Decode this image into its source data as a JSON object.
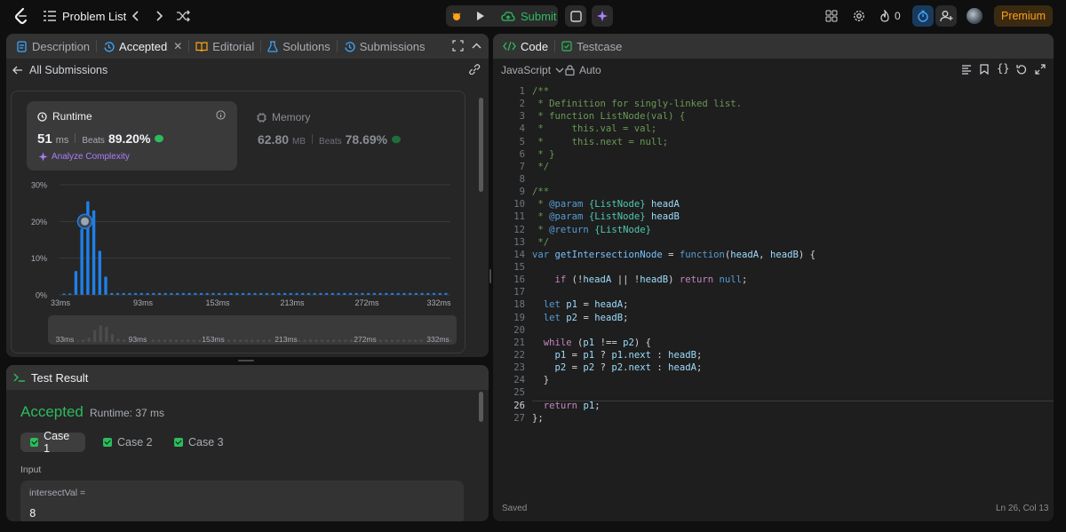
{
  "nav": {
    "problem_list": "Problem List",
    "submit": "Submit",
    "fire_count": "0",
    "premium": "Premium"
  },
  "left_tabs": {
    "description": "Description",
    "accepted": "Accepted",
    "editorial": "Editorial",
    "solutions": "Solutions",
    "submissions": "Submissions"
  },
  "submission": {
    "back_label": "All Submissions",
    "runtime_title": "Runtime",
    "runtime_value": "51",
    "runtime_unit": "ms",
    "beats_label": "Beats",
    "runtime_beats": "89.20%",
    "analyze": "Analyze Complexity",
    "memory_title": "Memory",
    "memory_value": "62.80",
    "memory_unit": "MB",
    "memory_beats": "78.69%"
  },
  "chart_data": {
    "type": "bar",
    "y_ticks": [
      "30%",
      "20%",
      "10%",
      "0%"
    ],
    "x_ticks": [
      "33ms",
      "93ms",
      "153ms",
      "213ms",
      "272ms",
      "332ms"
    ],
    "ylim": [
      0,
      30
    ],
    "values": [
      0.3,
      0.4,
      6.5,
      18,
      25.5,
      23,
      12,
      5,
      0.5,
      0.5,
      0.5,
      0.5,
      0.5,
      0.5,
      0.5,
      0.5,
      0.5,
      0.5,
      0.5,
      0.5,
      0.5,
      0.5,
      0.5,
      0.5,
      0.5,
      0.5,
      0.5,
      0.5,
      0.5,
      0.5,
      0.5,
      0.5,
      0.5,
      0.5,
      0.5,
      0.5,
      0.5,
      0.5,
      0.5,
      0.5,
      0.5,
      0.5,
      0.5,
      0.5,
      0.5,
      0.5,
      0.5,
      0.5,
      0.5,
      0.5,
      0.5,
      0.5,
      0.5,
      0.5,
      0.5,
      0.5,
      0.5,
      0.5,
      0.5,
      0.5,
      0.5,
      0.5,
      0.5,
      0.5,
      0.5
    ],
    "colors": {
      "bar": "#1f7fe8",
      "grid": "#3a3a3a",
      "mini_bar": "#4d4d4d"
    }
  },
  "test_result": {
    "title": "Test Result",
    "status": "Accepted",
    "runtime": "Runtime: 37 ms",
    "cases": [
      "Case 1",
      "Case 2",
      "Case 3"
    ],
    "input_label": "Input",
    "var_label": "intersectVal =",
    "var_value": "8"
  },
  "code_panel": {
    "tab_code": "Code",
    "tab_testcase": "Testcase",
    "language": "JavaScript",
    "auto": "Auto",
    "saved": "Saved",
    "position": "Ln 26, Col 13",
    "lines": [
      [
        [
          "c-cm",
          "/**"
        ]
      ],
      [
        [
          "c-cm",
          " * Definition for singly-linked list."
        ]
      ],
      [
        [
          "c-cm",
          " * function ListNode(val) {"
        ]
      ],
      [
        [
          "c-cm",
          " *     this.val = val;"
        ]
      ],
      [
        [
          "c-cm",
          " *     this.next = null;"
        ]
      ],
      [
        [
          "c-cm",
          " * }"
        ]
      ],
      [
        [
          "c-cm",
          " */"
        ]
      ],
      [],
      [
        [
          "c-cm",
          "/**"
        ]
      ],
      [
        [
          "c-cm",
          " * "
        ],
        [
          "c-bl",
          "@param"
        ],
        [
          "c-cm",
          " "
        ],
        [
          "c-ty",
          "{ListNode}"
        ],
        [
          "c-cm",
          " "
        ],
        [
          "c-id",
          "headA"
        ]
      ],
      [
        [
          "c-cm",
          " * "
        ],
        [
          "c-bl",
          "@param"
        ],
        [
          "c-cm",
          " "
        ],
        [
          "c-ty",
          "{ListNode}"
        ],
        [
          "c-cm",
          " "
        ],
        [
          "c-id",
          "headB"
        ]
      ],
      [
        [
          "c-cm",
          " * "
        ],
        [
          "c-bl",
          "@return"
        ],
        [
          "c-cm",
          " "
        ],
        [
          "c-ty",
          "{ListNode}"
        ]
      ],
      [
        [
          "c-cm",
          " */"
        ]
      ],
      [
        [
          "c-bl",
          "var"
        ],
        [
          "c-tx",
          " "
        ],
        [
          "c-fn",
          "getIntersectionNode"
        ],
        [
          "c-tx",
          " = "
        ],
        [
          "c-bl",
          "function"
        ],
        [
          "c-tx",
          "("
        ],
        [
          "c-id",
          "headA"
        ],
        [
          "c-tx",
          ", "
        ],
        [
          "c-id",
          "headB"
        ],
        [
          "c-tx",
          ") {"
        ]
      ],
      [],
      [
        [
          "c-tx",
          "    "
        ],
        [
          "c-kw",
          "if"
        ],
        [
          "c-tx",
          " (!"
        ],
        [
          "c-id",
          "headA"
        ],
        [
          "c-tx",
          " || !"
        ],
        [
          "c-id",
          "headB"
        ],
        [
          "c-tx",
          ") "
        ],
        [
          "c-kw",
          "return"
        ],
        [
          "c-tx",
          " "
        ],
        [
          "c-bl",
          "null"
        ],
        [
          "c-tx",
          ";"
        ]
      ],
      [],
      [
        [
          "c-tx",
          "  "
        ],
        [
          "c-bl",
          "let"
        ],
        [
          "c-tx",
          " "
        ],
        [
          "c-id",
          "p1"
        ],
        [
          "c-tx",
          " = "
        ],
        [
          "c-id",
          "headA"
        ],
        [
          "c-tx",
          ";"
        ]
      ],
      [
        [
          "c-tx",
          "  "
        ],
        [
          "c-bl",
          "let"
        ],
        [
          "c-tx",
          " "
        ],
        [
          "c-id",
          "p2"
        ],
        [
          "c-tx",
          " = "
        ],
        [
          "c-id",
          "headB"
        ],
        [
          "c-tx",
          ";"
        ]
      ],
      [],
      [
        [
          "c-tx",
          "  "
        ],
        [
          "c-kw",
          "while"
        ],
        [
          "c-tx",
          " ("
        ],
        [
          "c-id",
          "p1"
        ],
        [
          "c-tx",
          " !== "
        ],
        [
          "c-id",
          "p2"
        ],
        [
          "c-tx",
          ") {"
        ]
      ],
      [
        [
          "c-tx",
          "    "
        ],
        [
          "c-id",
          "p1"
        ],
        [
          "c-tx",
          " = "
        ],
        [
          "c-id",
          "p1"
        ],
        [
          "c-tx",
          " ? "
        ],
        [
          "c-id",
          "p1"
        ],
        [
          "c-tx",
          "."
        ],
        [
          "c-id",
          "next"
        ],
        [
          "c-tx",
          " : "
        ],
        [
          "c-id",
          "headB"
        ],
        [
          "c-tx",
          ";"
        ]
      ],
      [
        [
          "c-tx",
          "    "
        ],
        [
          "c-id",
          "p2"
        ],
        [
          "c-tx",
          " = "
        ],
        [
          "c-id",
          "p2"
        ],
        [
          "c-tx",
          " ? "
        ],
        [
          "c-id",
          "p2"
        ],
        [
          "c-tx",
          "."
        ],
        [
          "c-id",
          "next"
        ],
        [
          "c-tx",
          " : "
        ],
        [
          "c-id",
          "headA"
        ],
        [
          "c-tx",
          ";"
        ]
      ],
      [
        [
          "c-tx",
          "  }"
        ]
      ],
      [],
      [
        [
          "c-tx",
          "  "
        ],
        [
          "c-kw",
          "return"
        ],
        [
          "c-tx",
          " "
        ],
        [
          "c-id",
          "p1"
        ],
        [
          "c-tx",
          ";"
        ]
      ],
      [
        [
          "c-tx",
          "};"
        ]
      ]
    ]
  }
}
